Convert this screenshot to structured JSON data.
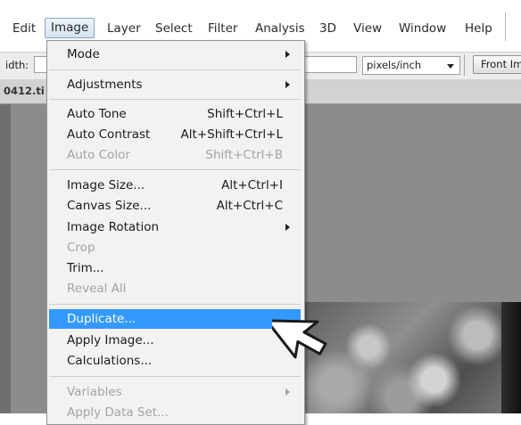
{
  "menubar": {
    "items": [
      {
        "label": "Edit"
      },
      {
        "label": "Image",
        "active": true
      },
      {
        "label": "Layer"
      },
      {
        "label": "Select"
      },
      {
        "label": "Filter"
      },
      {
        "label": "Analysis"
      },
      {
        "label": "3D"
      },
      {
        "label": "View"
      },
      {
        "label": "Window"
      },
      {
        "label": "Help"
      }
    ]
  },
  "options_bar": {
    "width_label": "idth:",
    "resolution_unit": "pixels/inch",
    "front_image_button": "Front Im"
  },
  "document": {
    "tab_label": "0412.ti"
  },
  "image_menu": {
    "items": [
      {
        "label": "Mode",
        "shortcut": "",
        "submenu": true,
        "enabled": true
      },
      {
        "label": "Adjustments",
        "shortcut": "",
        "submenu": true,
        "enabled": true
      },
      {
        "label": "Auto Tone",
        "shortcut": "Shift+Ctrl+L",
        "submenu": false,
        "enabled": true
      },
      {
        "label": "Auto Contrast",
        "shortcut": "Alt+Shift+Ctrl+L",
        "submenu": false,
        "enabled": true
      },
      {
        "label": "Auto Color",
        "shortcut": "Shift+Ctrl+B",
        "submenu": false,
        "enabled": false
      },
      {
        "label": "Image Size...",
        "shortcut": "Alt+Ctrl+I",
        "submenu": false,
        "enabled": true
      },
      {
        "label": "Canvas Size...",
        "shortcut": "Alt+Ctrl+C",
        "submenu": false,
        "enabled": true
      },
      {
        "label": "Image Rotation",
        "shortcut": "",
        "submenu": true,
        "enabled": true
      },
      {
        "label": "Crop",
        "shortcut": "",
        "submenu": false,
        "enabled": false
      },
      {
        "label": "Trim...",
        "shortcut": "",
        "submenu": false,
        "enabled": true
      },
      {
        "label": "Reveal All",
        "shortcut": "",
        "submenu": false,
        "enabled": false
      },
      {
        "label": "Duplicate...",
        "shortcut": "",
        "submenu": false,
        "enabled": true,
        "highlighted": true
      },
      {
        "label": "Apply Image...",
        "shortcut": "",
        "submenu": false,
        "enabled": true
      },
      {
        "label": "Calculations...",
        "shortcut": "",
        "submenu": false,
        "enabled": true
      },
      {
        "label": "Variables",
        "shortcut": "",
        "submenu": true,
        "enabled": false
      },
      {
        "label": "Apply Data Set...",
        "shortcut": "",
        "submenu": false,
        "enabled": false
      }
    ]
  },
  "colors": {
    "highlight": "#3399ff",
    "menu_bg": "#f2f2f2",
    "disabled_text": "#a3a3a3"
  },
  "icons": {
    "cursor": "pointer-arrow-icon",
    "submenu": "chevron-right-icon",
    "dropdown": "chevron-down-icon"
  }
}
